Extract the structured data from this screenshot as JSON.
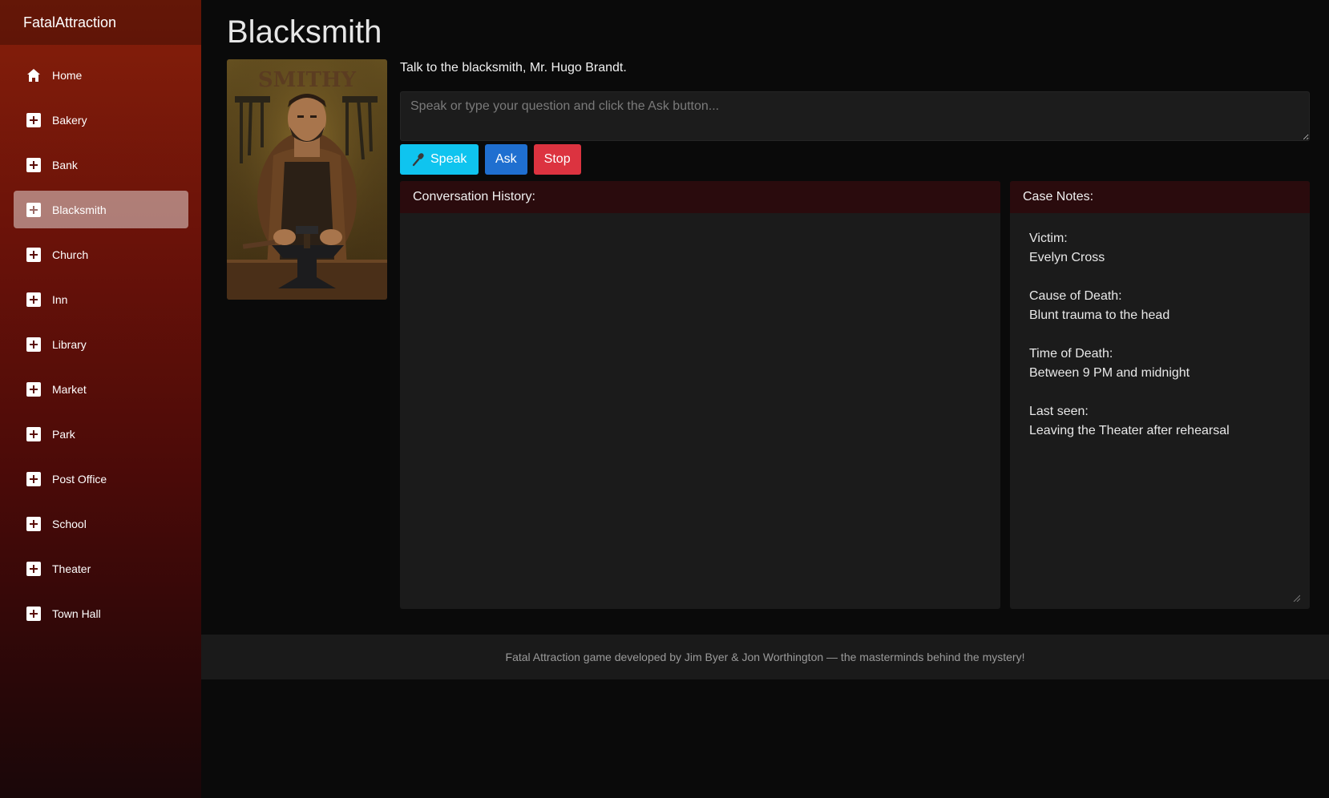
{
  "brand": "FatalAttraction",
  "nav": {
    "items": [
      {
        "label": "Home",
        "icon": "home-icon"
      },
      {
        "label": "Bakery",
        "icon": "plus-box-icon"
      },
      {
        "label": "Bank",
        "icon": "plus-box-icon"
      },
      {
        "label": "Blacksmith",
        "icon": "plus-box-icon",
        "active": true
      },
      {
        "label": "Church",
        "icon": "plus-box-icon"
      },
      {
        "label": "Inn",
        "icon": "plus-box-icon"
      },
      {
        "label": "Library",
        "icon": "plus-box-icon"
      },
      {
        "label": "Market",
        "icon": "plus-box-icon"
      },
      {
        "label": "Park",
        "icon": "plus-box-icon"
      },
      {
        "label": "Post Office",
        "icon": "plus-box-icon"
      },
      {
        "label": "School",
        "icon": "plus-box-icon"
      },
      {
        "label": "Theater",
        "icon": "plus-box-icon"
      },
      {
        "label": "Town Hall",
        "icon": "plus-box-icon"
      }
    ]
  },
  "main": {
    "title": "Blacksmith",
    "portrait_sign": "SMITHY",
    "intro": "Talk to the blacksmith, Mr. Hugo Brandt.",
    "question_placeholder": "Speak or type your question and click the Ask button...",
    "buttons": {
      "speak": "Speak",
      "ask": "Ask",
      "stop": "Stop"
    },
    "history": {
      "title": "Conversation History:"
    },
    "notes": {
      "title": "Case Notes:",
      "entries": [
        {
          "label": "Victim:",
          "value": "Evelyn Cross"
        },
        {
          "label": "Cause of Death:",
          "value": "Blunt trauma to the head"
        },
        {
          "label": "Time of Death:",
          "value": "Between 9 PM and midnight"
        },
        {
          "label": "Last seen:",
          "value": "Leaving the Theater after rehearsal"
        }
      ]
    }
  },
  "footer": "Fatal Attraction game developed by Jim Byer & Jon Worthington — the masterminds behind the mystery!",
  "colors": {
    "sidebar_top": "#861f0a",
    "speak": "#0fc4ef",
    "ask": "#1f6fd0",
    "stop": "#dc3340",
    "panel_head": "#2a0b0d"
  }
}
